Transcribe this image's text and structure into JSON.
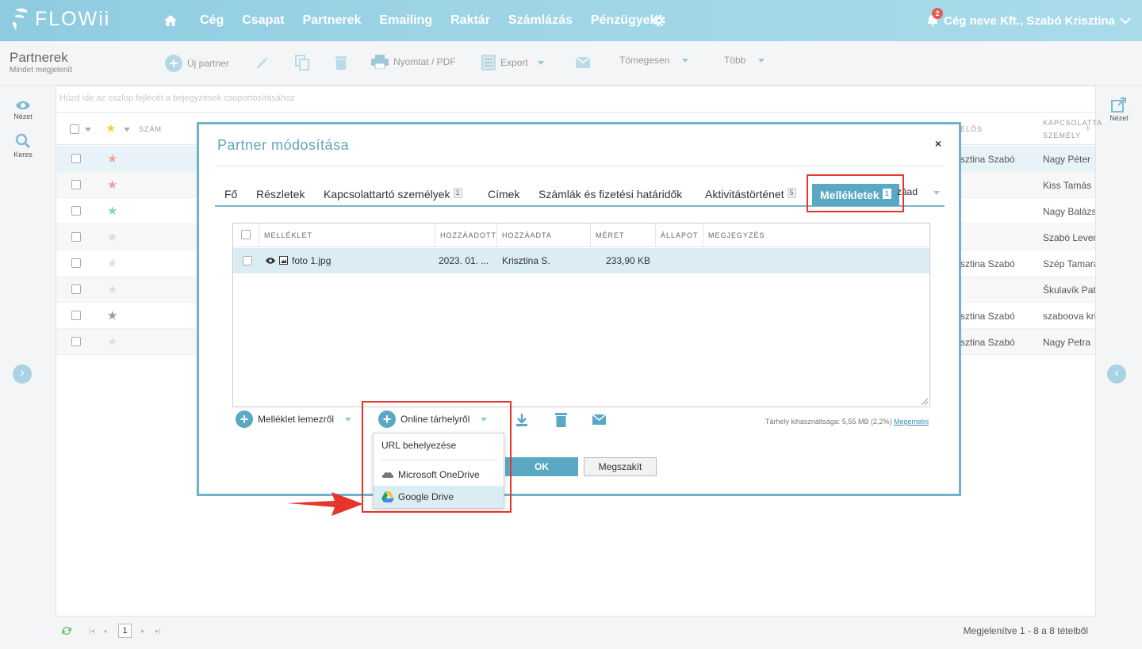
{
  "topnav": {
    "logo": "FLOWii",
    "items": [
      "Cég",
      "Csapat",
      "Partnerek",
      "Emailing",
      "Raktár",
      "Számlázás",
      "Pénzügyek"
    ],
    "notifications": "2",
    "user": "Cég neve Kft., Szabó Krisztina",
    "colors": {
      "bar": "#9dd4e6",
      "badge": "#e8594f"
    }
  },
  "toolbar": {
    "title": "Partnerek",
    "subtitle": "Mindet megjelenít",
    "new_label": "Új partner",
    "print_label": "Nyomtat / PDF",
    "export_label": "Export",
    "bulk_label": "Tömegesen",
    "more_label": "Több"
  },
  "left_sidebar": {
    "view_label": "Nézet",
    "search_label": "Keres"
  },
  "right_sidebar": {
    "view_label": "Nézet"
  },
  "grid": {
    "group_hint": "Húzd ide az oszlop fejlécét a bejegyzések csoportosításához",
    "headers": {
      "number": "SZÁM",
      "owner": "ELŐS",
      "contact": "KAPCSOLATTA SZEMÉLY"
    },
    "rows": [
      {
        "star_color": "#f2a58e",
        "owner": "sztina Szabó",
        "contact": "Nagy Péter"
      },
      {
        "star_color": "#e59bc8",
        "owner": "",
        "contact": "Kiss Tamás"
      },
      {
        "star_color": "#7dd3d3",
        "owner": "",
        "contact": "Nagy Balázs"
      },
      {
        "star_color": "#dddddd",
        "owner": "",
        "contact": "Szabó Leven"
      },
      {
        "star_color": "#dddddd",
        "owner": "sztina Szabó",
        "contact": "Szép Tamara"
      },
      {
        "star_color": "#dddddd",
        "owner": "",
        "contact": "Škulavík Pat"
      },
      {
        "star_color": "#999999",
        "owner": "sztina Szabó",
        "contact": "szaboova kri"
      },
      {
        "star_color": "#dddddd",
        "owner": "sztina Szabó",
        "contact": "Nagy Petra"
      }
    ],
    "footer_page": "1",
    "footer_info": "Megjelenítve 1 - 8 a 8 tételből"
  },
  "modal": {
    "title": "Partner módosítása",
    "close": "×",
    "tabs": [
      {
        "label": "Fő"
      },
      {
        "label": "Részletek"
      },
      {
        "label": "Kapcsolattartó személyek",
        "badge": "1"
      },
      {
        "label": "Címek"
      },
      {
        "label": "Számlák és fizetési határidők"
      },
      {
        "label": "Aktivitástörténet",
        "badge": "5"
      }
    ],
    "active_tab": {
      "label": "Mellékletek",
      "badge": "1"
    },
    "overflow_tab": "záad",
    "attachments": {
      "headers": [
        "MELLÉKLET",
        "HOZZÁADOTT",
        "HOZZÁADTA",
        "MÉRET",
        "ÁLLAPOT",
        "MEGJEGYZÉS"
      ],
      "rows": [
        {
          "name": "foto 1.jpg",
          "added": "2023. 01. ...",
          "added_by": "Krisztina S.",
          "size": "233,90 KB",
          "status": "",
          "note": ""
        }
      ]
    },
    "actions": {
      "from_disk": "Melléklet lemezről",
      "from_online": "Online tárhelyről",
      "storage_text": "Tárhely kihasználtsága: 5,55 MB (2,2%)",
      "upgrade_link": "Megemelni"
    },
    "ok_label": "OK",
    "cancel_label": "Megszakít"
  },
  "dropdown": {
    "items": [
      "URL behelyezése",
      "Microsoft OneDrive",
      "Google Drive"
    ],
    "highlighted": "Google Drive"
  },
  "accent_color": "#5aa8c4",
  "highlight_color": "#e8342a"
}
